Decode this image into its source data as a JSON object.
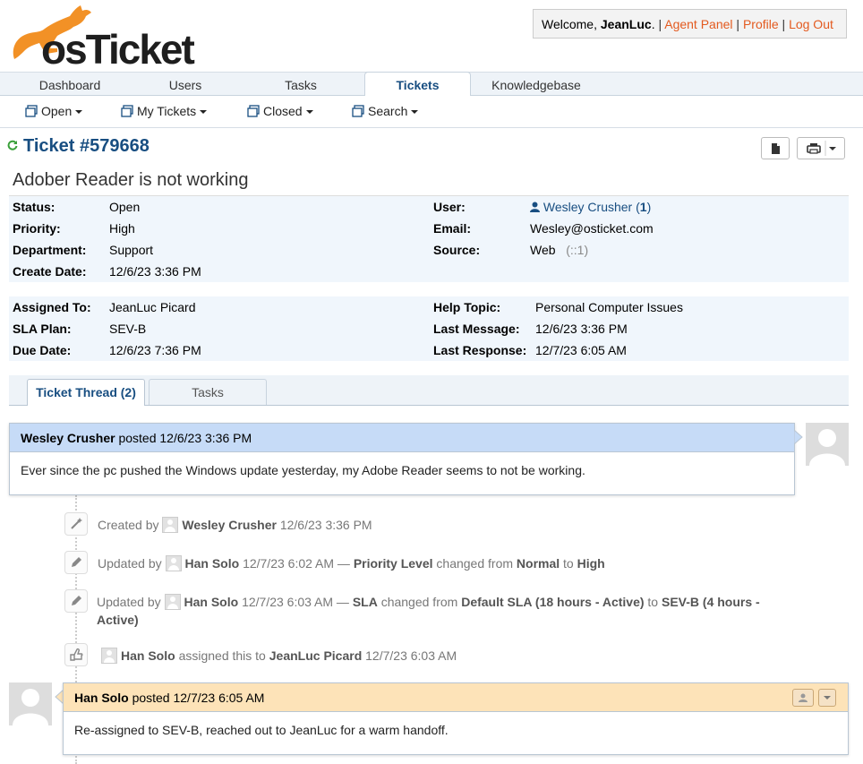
{
  "header": {
    "brand": "osTicket",
    "welcome_prefix": "Welcome,",
    "username": "JeanLuc",
    "links": [
      "Agent Panel",
      "Profile",
      "Log Out"
    ]
  },
  "nav": {
    "tabs": [
      "Dashboard",
      "Users",
      "Tasks",
      "Tickets",
      "Knowledgebase"
    ],
    "active": "Tickets"
  },
  "subnav": {
    "items": [
      "Open",
      "My Tickets",
      "Closed",
      "Search"
    ]
  },
  "ticket": {
    "title": "Ticket #579668",
    "subject": "Adober Reader is not working",
    "info1": {
      "status_label": "Status:",
      "status": "Open",
      "priority_label": "Priority:",
      "priority": "High",
      "department_label": "Department:",
      "department": "Support",
      "create_label": "Create Date:",
      "create_date": "12/6/23 3:36 PM",
      "user_label": "User:",
      "user": "Wesley Crusher",
      "user_count_open": "(",
      "user_count": "1",
      "user_count_close": ")",
      "email_label": "Email:",
      "email": "Wesley@osticket.com",
      "source_label": "Source:",
      "source": "Web",
      "source_ip": "(::1)"
    },
    "info2": {
      "assigned_label": "Assigned To:",
      "assigned": "JeanLuc Picard",
      "sla_label": "SLA Plan:",
      "sla": "SEV-B",
      "due_label": "Due Date:",
      "due": "12/6/23 7:36 PM",
      "topic_label": "Help Topic:",
      "topic": "Personal Computer Issues",
      "lastmsg_label": "Last Message:",
      "lastmsg": "12/6/23 3:36 PM",
      "lastresp_label": "Last Response:",
      "lastresp": "12/7/23 6:05 AM"
    }
  },
  "thread_tabs": [
    "Ticket Thread (2)",
    "Tasks"
  ],
  "thread": {
    "msg1": {
      "author": "Wesley Crusher",
      "posted": "posted 12/6/23 3:36 PM",
      "body": "Ever since the pc pushed the Windows update yesterday, my Adobe Reader seems to not be working."
    },
    "events": {
      "e1": {
        "prefix": "Created by",
        "who": "Wesley Crusher",
        "when": "12/6/23 3:36 PM"
      },
      "e2": {
        "prefix": "Updated by",
        "who": "Han Solo",
        "when": "12/7/23 6:02 AM —",
        "field": "Priority Level",
        "mid": "changed from",
        "from": "Normal",
        "to_word": "to",
        "to": "High"
      },
      "e3": {
        "prefix": "Updated by",
        "who": "Han Solo",
        "when": "12/7/23 6:03 AM —",
        "field": "SLA",
        "mid": "changed from",
        "from": "Default SLA (18 hours - Active)",
        "to_word": "to",
        "to_1": "SEV-B (4 hours -",
        "to_2": "Active)"
      },
      "e4": {
        "who": "Han Solo",
        "mid": "assigned this to",
        "target": "JeanLuc Picard",
        "when": "12/7/23 6:03 AM"
      }
    },
    "msg2": {
      "author": "Han Solo",
      "posted": "posted 12/7/23 6:05 AM",
      "body": "Re-assigned to SEV-B, reached out to JeanLuc for a warm handoff."
    }
  },
  "colors": {
    "accent_blue": "#184e81",
    "link_orange": "#e35a1f",
    "user_msg_head": "#c6dbf7",
    "agent_msg_head": "#fde3b8",
    "info_bg": "#f0f6fc"
  }
}
